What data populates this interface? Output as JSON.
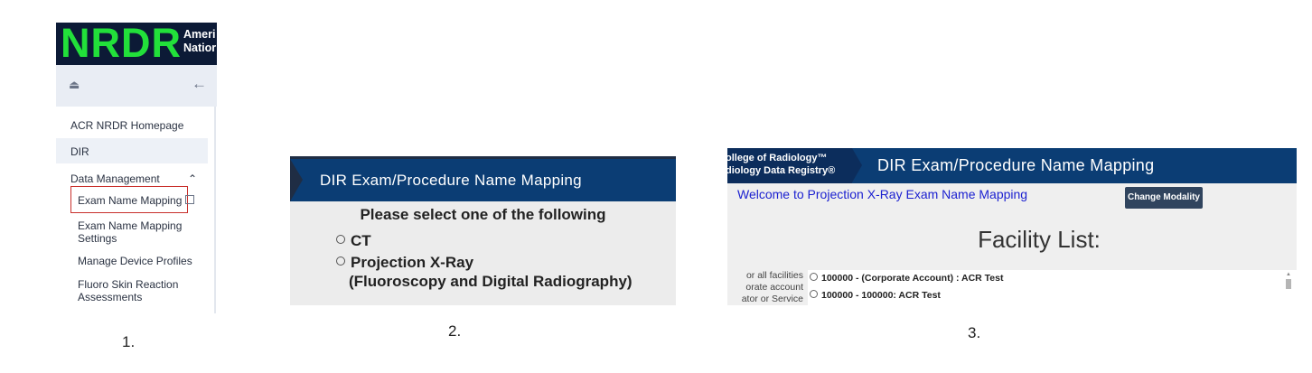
{
  "panel1": {
    "logo": "NRDR",
    "logo_sub_line1": "Ameri",
    "logo_sub_line2": "Natior",
    "menu": {
      "homepage": "ACR NRDR Homepage",
      "dir": "DIR",
      "data_management": "Data Management",
      "sub_items": {
        "exam_name_mapping": "Exam Name Mapping",
        "exam_name_mapping_settings_l1": "Exam Name Mapping",
        "exam_name_mapping_settings_l2": "Settings",
        "manage_device_profiles": "Manage Device Profiles",
        "fluoro_l1": "Fluoro Skin Reaction",
        "fluoro_l2": "Assessments"
      }
    }
  },
  "panel2": {
    "header": "DIR Exam/Procedure Name Mapping",
    "prompt": "Please select one of the following",
    "options": {
      "ct": "CT",
      "xray_l1": "Projection X-Ray",
      "xray_l2": "(Fluoroscopy and Digital Radiography)"
    }
  },
  "panel3": {
    "brand_l1": "ollege of Radiology™",
    "brand_l2": "diology Data Registry®",
    "header": "DIR Exam/Procedure Name Mapping",
    "welcome": "Welcome to Projection X-Ray Exam Name Mapping",
    "change_modality": "Change Modality",
    "facility_list_title": "Facility List:",
    "left_text_l1": "or all facilities",
    "left_text_l2": "orate account",
    "left_text_l3": "ator or Service",
    "facilities": [
      "100000 - (Corporate Account) : ACR Test",
      "100000 - 100000: ACR Test"
    ]
  },
  "captions": {
    "c1": "1.",
    "c2": "2.",
    "c3": "3."
  }
}
